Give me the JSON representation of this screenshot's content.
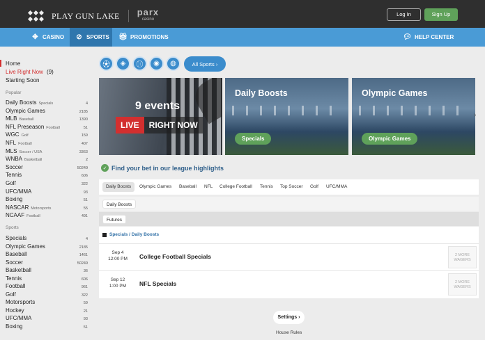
{
  "header": {
    "brand": "PLAY GUN LAKE",
    "partner_main": "parx",
    "partner_sub": "casino",
    "login": "Log In",
    "signup": "Sign Up"
  },
  "nav": {
    "casino": "CASINO",
    "sports": "SPORTS",
    "promotions": "PROMOTIONS",
    "help": "HELP CENTER"
  },
  "sidebar": {
    "top": [
      {
        "label": "Home"
      },
      {
        "label": "Live Right Now",
        "count": "(9)"
      },
      {
        "label": "Starting Soon"
      }
    ],
    "popular_heading": "Popular",
    "popular": [
      {
        "name": "Daily Boosts",
        "sub": "Specials",
        "count": "4"
      },
      {
        "name": "Olympic Games",
        "sub": "",
        "count": "2185"
      },
      {
        "name": "MLB",
        "sub": "Baseball",
        "count": "1390"
      },
      {
        "name": "NFL Preseason",
        "sub": "Football",
        "count": "51"
      },
      {
        "name": "WGC",
        "sub": "Golf",
        "count": "159"
      },
      {
        "name": "NFL",
        "sub": "Football",
        "count": "407"
      },
      {
        "name": "MLS",
        "sub": "Soccer / USA",
        "count": "3363"
      },
      {
        "name": "WNBA",
        "sub": "Basketball",
        "count": "2"
      },
      {
        "name": "Soccer",
        "sub": "",
        "count": "50249"
      },
      {
        "name": "Tennis",
        "sub": "",
        "count": "606"
      },
      {
        "name": "Golf",
        "sub": "",
        "count": "322"
      },
      {
        "name": "UFC/MMA",
        "sub": "",
        "count": "93"
      },
      {
        "name": "Boxing",
        "sub": "",
        "count": "51"
      },
      {
        "name": "NASCAR",
        "sub": "Motorsports",
        "count": "55"
      },
      {
        "name": "NCAAF",
        "sub": "Football",
        "count": "491"
      }
    ],
    "sports_heading": "Sports",
    "sports": [
      {
        "name": "Specials",
        "count": "4"
      },
      {
        "name": "Olympic Games",
        "count": "2185"
      },
      {
        "name": "Baseball",
        "count": "1461"
      },
      {
        "name": "Soccer",
        "count": "50249"
      },
      {
        "name": "Basketball",
        "count": "36"
      },
      {
        "name": "Tennis",
        "count": "606"
      },
      {
        "name": "Football",
        "count": "961"
      },
      {
        "name": "Golf",
        "count": "322"
      },
      {
        "name": "Motorsports",
        "count": "59"
      },
      {
        "name": "Hockey",
        "count": "21"
      },
      {
        "name": "UFC/MMA",
        "count": "93"
      },
      {
        "name": "Boxing",
        "count": "51"
      }
    ]
  },
  "filters": {
    "icons": [
      "soccer-ball-icon",
      "football-icon",
      "baseball-icon",
      "soccer-icon",
      "basketball-icon"
    ],
    "all_sports": "All Sports ›"
  },
  "banners": {
    "live": {
      "events": "9 events",
      "live": "LIVE",
      "right_now": "RIGHT NOW"
    },
    "daily_boosts": {
      "title": "Daily Boosts",
      "button": "Specials"
    },
    "olympic": {
      "title": "Olympic Games",
      "button": "Olympic Games"
    },
    "arrow": "›"
  },
  "highlights": {
    "title": "Find your bet in our league highlights",
    "tabs": [
      "Daily Boosts",
      "Olympic Games",
      "Baseball",
      "NFL",
      "College Football",
      "Tennis",
      "Top Soccer",
      "Golf",
      "UFC/MMA"
    ],
    "sub1": "Daily Boosts",
    "sub2": "Futures",
    "crumb": "Specials / Daily Boosts",
    "events": [
      {
        "date": "Sep 4",
        "time": "12:00 PM",
        "name": "College Football Specials",
        "more": "2 MORE WAGERS"
      },
      {
        "date": "Sep 12",
        "time": "1:00 PM",
        "name": "NFL Specials",
        "more": "2 MORE WAGERS"
      }
    ]
  },
  "footer": {
    "settings": "Settings ›",
    "rules": "House Rules"
  },
  "colors": {
    "nav": "#4a9bd6",
    "nav_active": "#2f76ad",
    "green": "#5fa15a",
    "live_red": "#d32f2f",
    "topbar": "#2f2f2f"
  }
}
